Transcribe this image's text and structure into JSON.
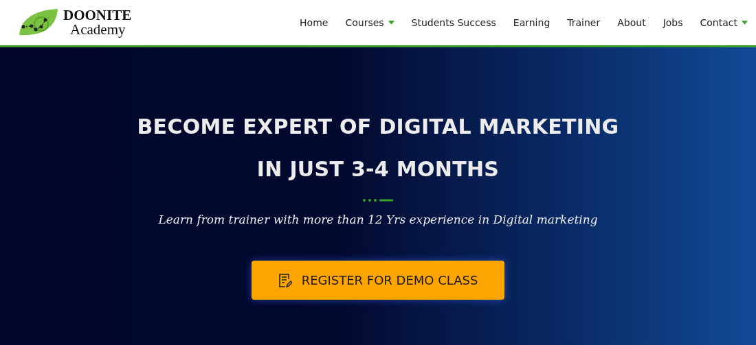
{
  "logo": {
    "name": "DOONITE",
    "sub": "Academy"
  },
  "nav": [
    {
      "label": "Home",
      "dropdown": false
    },
    {
      "label": "Courses",
      "dropdown": true
    },
    {
      "label": "Students Success",
      "dropdown": false
    },
    {
      "label": "Earning",
      "dropdown": false
    },
    {
      "label": "Trainer",
      "dropdown": false
    },
    {
      "label": "About",
      "dropdown": false
    },
    {
      "label": "Jobs",
      "dropdown": false
    },
    {
      "label": "Contact",
      "dropdown": true
    }
  ],
  "hero": {
    "headline": [
      "BECOME EXPERT OF DIGITAL MARKETING",
      "IN JUST 3-4 MONTHS"
    ],
    "subtitle": "Learn from trainer with more than 12 Yrs experience in Digital marketing",
    "button": "REGISTER FOR DEMO CLASS"
  }
}
